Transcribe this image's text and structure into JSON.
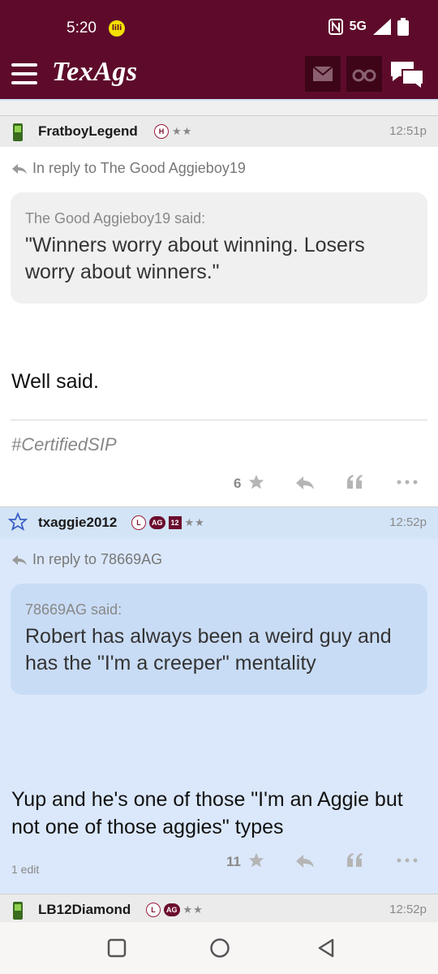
{
  "status": {
    "time": "5:20",
    "network": "5G",
    "notif_label": "lili"
  },
  "app": {
    "logo": "TexAgs"
  },
  "icons": {
    "menu": "hamburger-icon",
    "mail": "mail-icon",
    "binoculars": "binoculars-icon",
    "chat": "chat-bubbles-icon"
  },
  "posts": [
    {
      "username": "FratboyLegend",
      "badges": [
        "H"
      ],
      "stars": "★★",
      "time": "12:51p",
      "reply_to": "In reply to The Good Aggieboy19",
      "quote_by": "The Good Aggieboy19 said:",
      "quote_text": "\"Winners worry about winning. Losers worry about winners.\"",
      "body": "Well said.",
      "signature": "#CertifiedSIP",
      "star_count": "6"
    },
    {
      "username": "txaggie2012",
      "badges": [
        "L",
        "AG",
        "12"
      ],
      "stars": "★★",
      "time": "12:52p",
      "reply_to": "In reply to 78669AG",
      "quote_by": "78669AG said:",
      "quote_text": "Robert has always been a weird guy and has the \"I'm a creeper\" mentality",
      "body": "Yup and he's one of those \"I'm an Aggie but not one of those aggies\" types",
      "star_count": "11",
      "edit_note": "1 edit"
    },
    {
      "username": "LB12Diamond",
      "badges": [
        "L",
        "AG"
      ],
      "stars": "★★",
      "time": "12:52p"
    }
  ],
  "colors": {
    "maroon": "#5e0b2b",
    "highlight_blue": "#dbe8fb"
  }
}
